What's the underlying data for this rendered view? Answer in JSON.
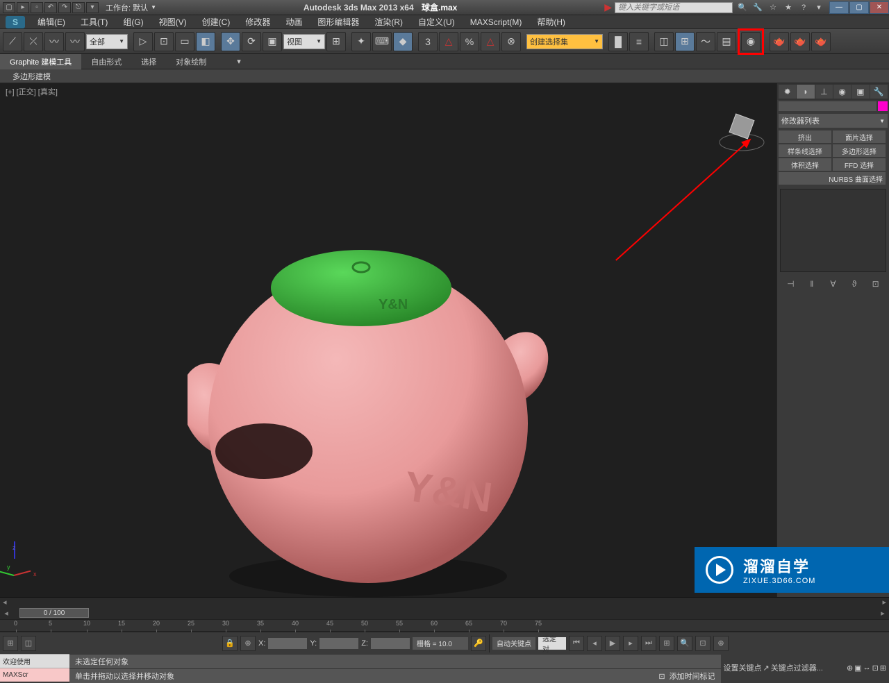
{
  "titlebar": {
    "workspace_label": "工作台: 默认",
    "app_title": "Autodesk 3ds Max  2013 x64",
    "file_name": "球盒.max",
    "search_placeholder": "键入关键字或短语"
  },
  "menubar": {
    "items": [
      "编辑(E)",
      "工具(T)",
      "组(G)",
      "视图(V)",
      "创建(C)",
      "修改器",
      "动画",
      "图形编辑器",
      "渲染(R)",
      "自定义(U)",
      "MAXScript(M)",
      "帮助(H)"
    ]
  },
  "maintoolbar": {
    "filter_combo": "全部",
    "view_combo": "视图",
    "selection_set": "创建选择集"
  },
  "ribbon": {
    "tabs": [
      "Graphite 建模工具",
      "自由形式",
      "选择",
      "对象绘制"
    ],
    "subtab": "多边形建模"
  },
  "viewport": {
    "label": "[+] [正交] [真实]",
    "embossed_text_lid": "Y&N",
    "embossed_text_body": "Y&N"
  },
  "command_panel": {
    "modifier_list": "修改器列表",
    "buttons": [
      "挤出",
      "面片选择",
      "样条线选择",
      "多边形选择",
      "体积选择",
      "FFD 选择",
      "NURBS 曲面选择"
    ]
  },
  "timeline": {
    "handle": "0 / 100",
    "ticks": [
      "0",
      "5",
      "10",
      "15",
      "20",
      "25",
      "30",
      "35",
      "40",
      "45",
      "50",
      "55",
      "60",
      "65",
      "70",
      "75"
    ]
  },
  "statusbar": {
    "no_selection": "未选定任何对象",
    "hint": "单击并拖动以选择并移动对象",
    "x_label": "X:",
    "y_label": "Y:",
    "z_label": "Z:",
    "grid_label": "栅格 = 10.0",
    "add_time_tag": "添加时间标记",
    "auto_key": "自动关键点",
    "set_key": "设置关键点",
    "selected": "选定对",
    "key_filter": "关键点过滤器...",
    "welcome": "欢迎使用",
    "maxscript": "MAXScr"
  },
  "watermark": {
    "cn": "溜溜自学",
    "en": "ZIXUE.3D66.COM"
  }
}
